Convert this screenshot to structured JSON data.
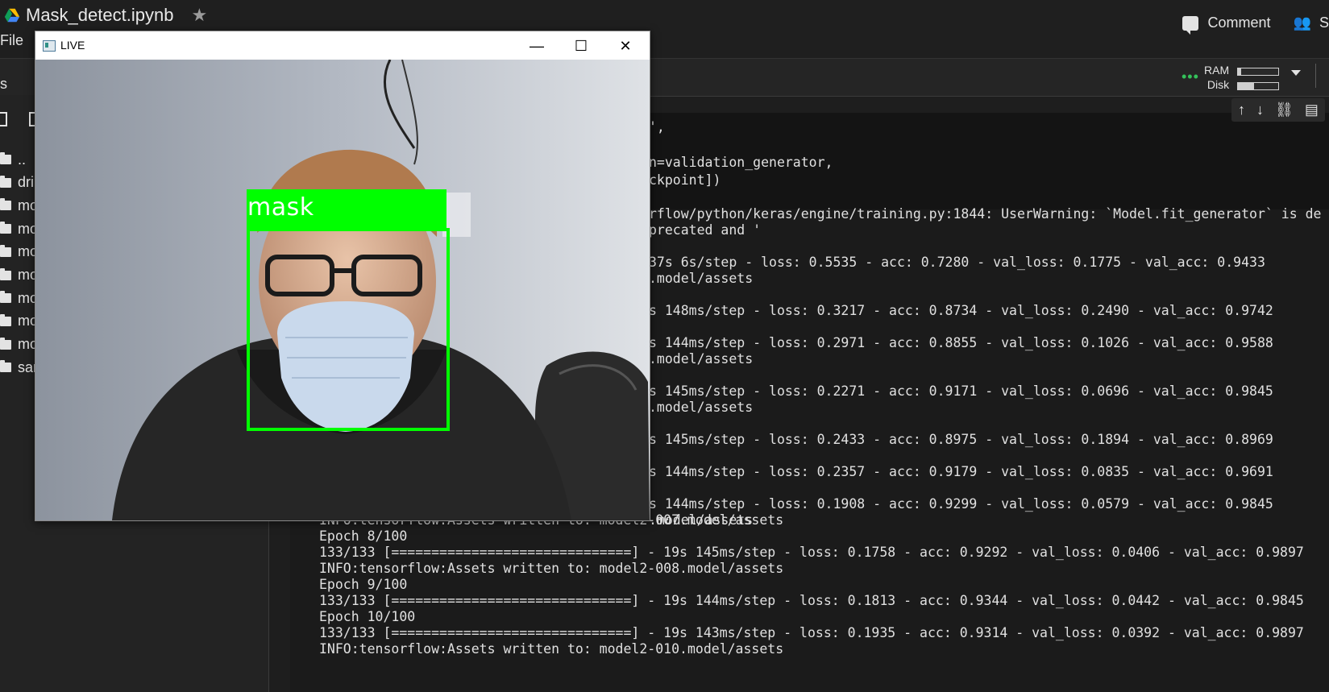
{
  "header": {
    "notebook_title": "Mask_detect.ipynb",
    "menu_file": "File",
    "comment_label": "Comment",
    "share_label": "S"
  },
  "resources": {
    "ram_label": "RAM",
    "disk_label": "Disk",
    "ram_usage": 0.08,
    "disk_usage": 0.4
  },
  "sidebar": {
    "section_label": "s",
    "files": [
      {
        "name": ".."
      },
      {
        "name": "dri"
      },
      {
        "name": "mo"
      },
      {
        "name": "mo"
      },
      {
        "name": "mo"
      },
      {
        "name": "mo"
      },
      {
        "name": "mo"
      },
      {
        "name": "mo"
      },
      {
        "name": "mo"
      },
      {
        "name": "sar"
      }
    ]
  },
  "cell": {
    "code_lines": [
      "',",
      "",
      "n=validation_generator,",
      "ckpoint])"
    ],
    "output_lines": [
      "rflow/python/keras/engine/training.py:1844: UserWarning: `Model.fit_generator` is de",
      "precated and '",
      "",
      "37s 6s/step - loss: 0.5535 - acc: 0.7280 - val_loss: 0.1775 - val_acc: 0.9433",
      ".model/assets",
      "",
      "s 148ms/step - loss: 0.3217 - acc: 0.8734 - val_loss: 0.2490 - val_acc: 0.9742",
      "",
      "s 144ms/step - loss: 0.2971 - acc: 0.8855 - val_loss: 0.1026 - val_acc: 0.9588",
      ".model/assets",
      "",
      "s 145ms/step - loss: 0.2271 - acc: 0.9171 - val_loss: 0.0696 - val_acc: 0.9845",
      ".model/assets",
      "",
      "s 145ms/step - loss: 0.2433 - acc: 0.8975 - val_loss: 0.1894 - val_acc: 0.8969",
      "",
      "s 144ms/step - loss: 0.2357 - acc: 0.9179 - val_loss: 0.0835 - val_acc: 0.9691",
      "",
      "s 144ms/step - loss: 0.1908 - acc: 0.9299 - val_loss: 0.0579 - val_acc: 0.9845",
      ".model/assets"
    ],
    "full_lines": [
      "INFO:tensorflow:Assets written to: model2-007.model/assets",
      "Epoch 8/100",
      "133/133 [==============================] - 19s 145ms/step - loss: 0.1758 - acc: 0.9292 - val_loss: 0.0406 - val_acc: 0.9897",
      "INFO:tensorflow:Assets written to: model2-008.model/assets",
      "Epoch 9/100",
      "133/133 [==============================] - 19s 144ms/step - loss: 0.1813 - acc: 0.9344 - val_loss: 0.0442 - val_acc: 0.9845",
      "Epoch 10/100",
      "133/133 [==============================] - 19s 143ms/step - loss: 0.1935 - acc: 0.9314 - val_loss: 0.0392 - val_acc: 0.9897",
      "INFO:tensorflow:Assets written to: model2-010.model/assets"
    ]
  },
  "live_window": {
    "title": "LIVE",
    "minimize": "—",
    "maximize": "☐",
    "close": "✕",
    "detection_label": "mask",
    "detection_color": "#00ff00"
  }
}
